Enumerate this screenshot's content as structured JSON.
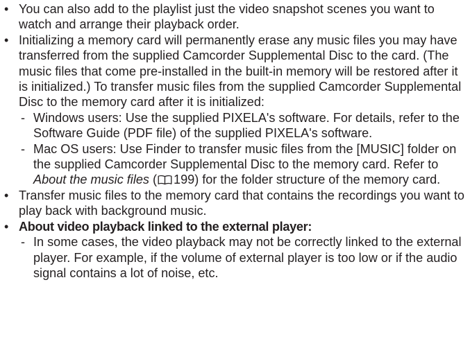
{
  "bullets": [
    {
      "text": "You can also add to the playlist just the video snapshot scenes you want to watch and arrange their playback order."
    },
    {
      "text": "Initializing a memory card will permanently erase any music files you may have transferred from the supplied Camcorder Supplemental Disc to the card. (The music files that come pre-installed in the built-in memory will be restored after it is initialized.) To transfer music files from the supplied Camcorder Supplemental Disc to the memory card after it is initialized:",
      "sub": [
        "Windows users: Use the supplied PIXELA's software. For details, refer to the Software Guide (PDF file) of the supplied PIXELA's software."
      ],
      "mac": {
        "before": "Mac OS users: Use Finder to transfer music files from the [MUSIC] folder on the supplied Camcorder Supplemental Disc to the memory card. Refer to ",
        "italic": "About the music files",
        "paren_open": " (",
        "page_ref": "199",
        "after": ") for the folder structure of the memory card.",
        "icon": "book-icon"
      }
    },
    {
      "text": "Transfer music files to the memory card that contains the recordings you want to play back with background music."
    },
    {
      "heading": "About video playback linked to the external player:",
      "sub": [
        "In some cases, the video playback may not be correctly linked to the external player. For example, if the volume of external player is too low or if the audio signal contains a lot of noise, etc."
      ]
    }
  ]
}
